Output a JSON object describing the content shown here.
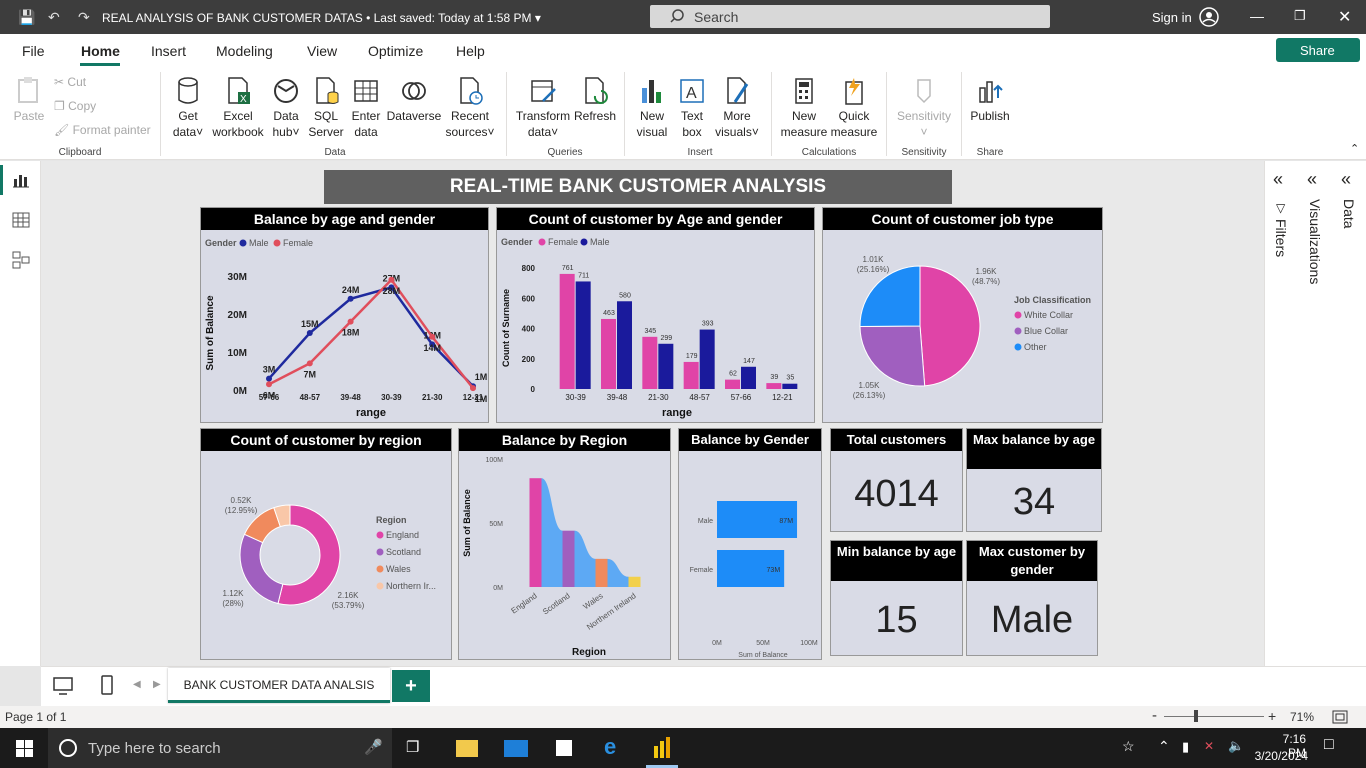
{
  "window": {
    "title": "REAL ANALYSIS OF BANK CUSTOMER DATAS",
    "saved": "• Last saved: Today at 1:58 PM",
    "search_placeholder": "Search",
    "sign_in": "Sign in"
  },
  "menu": {
    "items": [
      "File",
      "Home",
      "Insert",
      "Modeling",
      "View",
      "Optimize",
      "Help"
    ],
    "active": "Home",
    "share": "Share"
  },
  "ribbon": {
    "clipboard": {
      "paste": "Paste",
      "cut": "Cut",
      "copy": "Copy",
      "format_painter": "Format painter",
      "group": "Clipboard"
    },
    "data": {
      "get_data_1": "Get",
      "get_data_2": "data",
      "excel_1": "Excel",
      "excel_2": "workbook",
      "hub_1": "Data",
      "hub_2": "hub",
      "sql_1": "SQL",
      "sql_2": "Server",
      "enter_1": "Enter",
      "enter_2": "data",
      "dataverse": "Dataverse",
      "recent_1": "Recent",
      "recent_2": "sources",
      "group": "Data"
    },
    "queries": {
      "transform_1": "Transform",
      "transform_2": "data",
      "refresh": "Refresh",
      "group": "Queries"
    },
    "insert": {
      "new_visual_1": "New",
      "new_visual_2": "visual",
      "text_box_1": "Text",
      "text_box_2": "box",
      "more_1": "More",
      "more_2": "visuals",
      "group": "Insert"
    },
    "calculations": {
      "new_measure_1": "New",
      "new_measure_2": "measure",
      "quick_1": "Quick",
      "quick_2": "measure",
      "group": "Calculations"
    },
    "sensitivity": {
      "label": "Sensitivity",
      "group": "Sensitivity"
    },
    "share": {
      "publish": "Publish",
      "group": "Share"
    }
  },
  "report": {
    "title": "REAL-TIME BANK CUSTOMER ANALYSIS",
    "kpis": {
      "total_customers": {
        "label": "Total customers",
        "value": "4014"
      },
      "max_balance_age": {
        "label": "Max balance by age",
        "value": "34"
      },
      "min_balance_age": {
        "label": "Min balance by age",
        "value": "15"
      },
      "max_customer_gender": {
        "label": "Max customer by gender",
        "value": "Male"
      }
    }
  },
  "chart_data": [
    {
      "id": "balance_age_gender",
      "type": "line",
      "title": "Balance by age and gender",
      "legend_title": "Gender",
      "legend": [
        "Male",
        "Female"
      ],
      "xlabel": "range",
      "ylabel": "Sum of Balance",
      "categories": [
        "57-66",
        "48-57",
        "39-48",
        "30-39",
        "21-30",
        "12-21"
      ],
      "yticks": [
        "0M",
        "10M",
        "20M",
        "30M"
      ],
      "ylim": [
        0,
        30
      ],
      "series": [
        {
          "name": "Male",
          "color": "#1f2a9e",
          "values": [
            3,
            15,
            24,
            27,
            12,
            1
          ],
          "labels": [
            "3M",
            "15M",
            "24M",
            "27M",
            "12M",
            "1M"
          ]
        },
        {
          "name": "Female",
          "color": "#e04e5c",
          "values": [
            1.5,
            7,
            18,
            29,
            14,
            0.5
          ],
          "labels": [
            "6M",
            "7M",
            "18M",
            "28M",
            "14M",
            "1M"
          ]
        }
      ]
    },
    {
      "id": "count_age_gender",
      "type": "bar",
      "title": "Count of customer by Age and gender",
      "legend_title": "Gender",
      "legend": [
        "Female",
        "Male"
      ],
      "xlabel": "range",
      "ylabel": "Count of Surname",
      "categories": [
        "30-39",
        "39-48",
        "21-30",
        "48-57",
        "57-66",
        "12-21"
      ],
      "yticks": [
        "0",
        "200",
        "400",
        "600",
        "800"
      ],
      "ylim": [
        0,
        800
      ],
      "series": [
        {
          "name": "Female",
          "color": "#e044a7",
          "values": [
            761,
            463,
            345,
            179,
            62,
            39
          ]
        },
        {
          "name": "Male",
          "color": "#1a1a9c",
          "values": [
            711,
            580,
            299,
            393,
            147,
            35
          ]
        }
      ]
    },
    {
      "id": "job_type",
      "type": "pie",
      "title": "Count of customer job type",
      "legend_title": "Job Classification",
      "slices": [
        {
          "name": "White Collar",
          "value": 1960,
          "label": "1.96K",
          "pct": "(48.7%)",
          "color": "#e044a7"
        },
        {
          "name": "Blue Collar",
          "value": 1050,
          "label": "1.05K",
          "pct": "(26.13%)",
          "color": "#a05fbf"
        },
        {
          "name": "Other",
          "value": 1010,
          "label": "1.01K",
          "pct": "(25.16%)",
          "color": "#1d8cf8"
        }
      ]
    },
    {
      "id": "region_count",
      "type": "pie",
      "title": "Count of customer by region",
      "legend_title": "Region",
      "slices": [
        {
          "name": "England",
          "value": 2160,
          "label": "2.16K",
          "pct": "(53.79%)",
          "color": "#e044a7"
        },
        {
          "name": "Scotland",
          "value": 1120,
          "label": "1.12K",
          "pct": "(28%)",
          "color": "#a05fbf"
        },
        {
          "name": "Wales",
          "value": 520,
          "label": "0.52K",
          "pct": "(12.95%)",
          "color": "#f08a5d"
        },
        {
          "name": "Northern Ir...",
          "value": 210,
          "label": "",
          "pct": "",
          "color": "#f9c7a8"
        }
      ]
    },
    {
      "id": "balance_region",
      "type": "bar",
      "title": "Balance by Region",
      "xlabel": "Region",
      "ylabel": "Sum of Balance",
      "categories": [
        "England",
        "Scotland",
        "Wales",
        "Northern Ireland"
      ],
      "yticks": [
        "0M",
        "50M",
        "100M"
      ],
      "ylim": [
        0,
        100
      ],
      "values": [
        85,
        44,
        22,
        8
      ],
      "colors": [
        "#e044a7",
        "#a05fbf",
        "#f08a5d",
        "#f2d04b"
      ]
    },
    {
      "id": "balance_gender",
      "type": "bar",
      "title": "Balance by Gender",
      "xlabel": "Sum of Balance",
      "categories": [
        "Male",
        "Female"
      ],
      "values": [
        87,
        73
      ],
      "labels": [
        "87M",
        "73M"
      ],
      "xticks": [
        "0M",
        "50M",
        "100M"
      ],
      "xlim": [
        0,
        100
      ],
      "color": "#1d8cf8"
    }
  ],
  "panes": {
    "filters": "Filters",
    "visualizations": "Visualizations",
    "data": "Data"
  },
  "page_tab": "BANK CUSTOMER DATA ANALSIS",
  "status": {
    "page": "Page 1 of 1",
    "zoom": "71%"
  },
  "taskbar": {
    "search": "Type here to search",
    "time": "7:16 PM",
    "date": "3/20/2024"
  }
}
